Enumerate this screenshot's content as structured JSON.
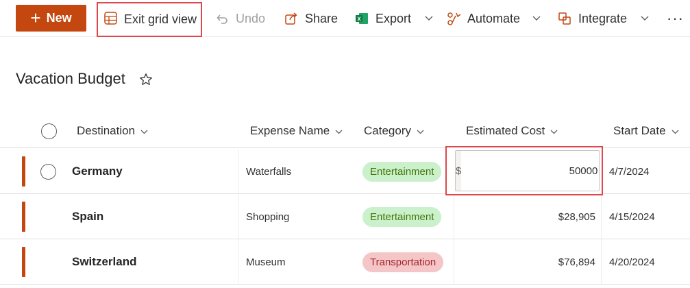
{
  "toolbar": {
    "new_label": "New",
    "exit_grid_label": "Exit grid view",
    "undo_label": "Undo",
    "share_label": "Share",
    "export_label": "Export",
    "automate_label": "Automate",
    "integrate_label": "Integrate",
    "more_label": "···"
  },
  "list": {
    "title": "Vacation Budget"
  },
  "columns": [
    "Destination",
    "Expense Name",
    "Category",
    "Estimated Cost",
    "Start Date"
  ],
  "rows": [
    {
      "destination": "Germany",
      "expense": "Waterfalls",
      "category": "Entertainment",
      "category_color": "green",
      "cost_value": "50000",
      "currency_symbol": "$",
      "start_date": "4/7/2024",
      "editing": true
    },
    {
      "destination": "Spain",
      "expense": "Shopping",
      "category": "Entertainment",
      "category_color": "green",
      "cost": "$28,905",
      "start_date": "4/15/2024"
    },
    {
      "destination": "Switzerland",
      "expense": "Museum",
      "category": "Transportation",
      "category_color": "red",
      "cost": "$76,894",
      "start_date": "4/20/2024"
    }
  ],
  "colors": {
    "accent": "#c4470f",
    "highlight_border": "#e0474c",
    "pill_green_bg": "#caf0cc",
    "pill_red_bg": "#f4c6c8"
  },
  "icons": [
    "plus-icon",
    "grid-icon",
    "undo-icon",
    "share-icon",
    "excel-icon",
    "automate-icon",
    "integrate-icon",
    "chevron-down-icon",
    "more-icon",
    "star-icon"
  ]
}
